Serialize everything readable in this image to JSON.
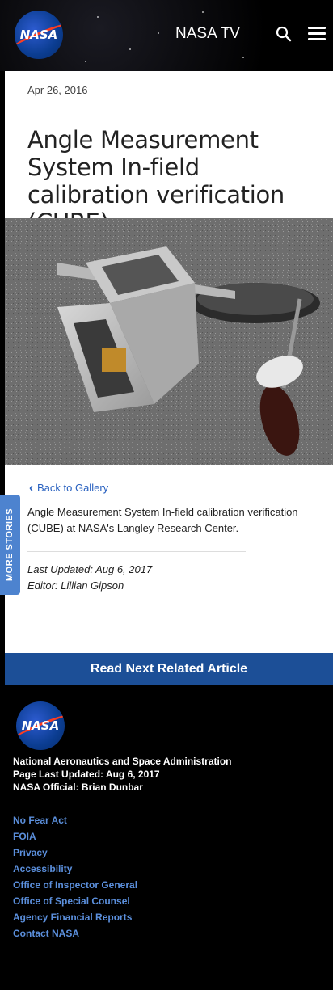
{
  "header": {
    "logo_text": "NASA",
    "nav_title": "NASA TV"
  },
  "article": {
    "date": "Apr 26, 2016",
    "title": "Angle Measurement System In-field calibration verification (CUBE)",
    "back_label": "Back to Gallery",
    "caption": "Angle Measurement System In-field calibration verification (CUBE) at NASA's Langley Research Center.",
    "last_updated": "Last Updated: Aug 6, 2017",
    "editor": "Editor: Lillian Gipson"
  },
  "side_tab": {
    "label": "MORE STORIES"
  },
  "related": {
    "label": "Read Next Related Article"
  },
  "footer": {
    "logo_text": "NASA",
    "org_name": "National Aeronautics and Space Administration",
    "page_updated": "Page Last Updated: Aug 6, 2017",
    "official": "NASA Official: Brian Dunbar",
    "links": [
      "No Fear Act",
      "FOIA",
      "Privacy",
      "Accessibility",
      "Office of Inspector General",
      "Office of Special Counsel",
      "Agency Financial Reports",
      "Contact NASA"
    ]
  },
  "colors": {
    "accent_blue": "#1c4f97",
    "tab_blue": "#4d83cf",
    "link_blue": "#2a62c0",
    "nasa_red": "#fc3d21"
  }
}
